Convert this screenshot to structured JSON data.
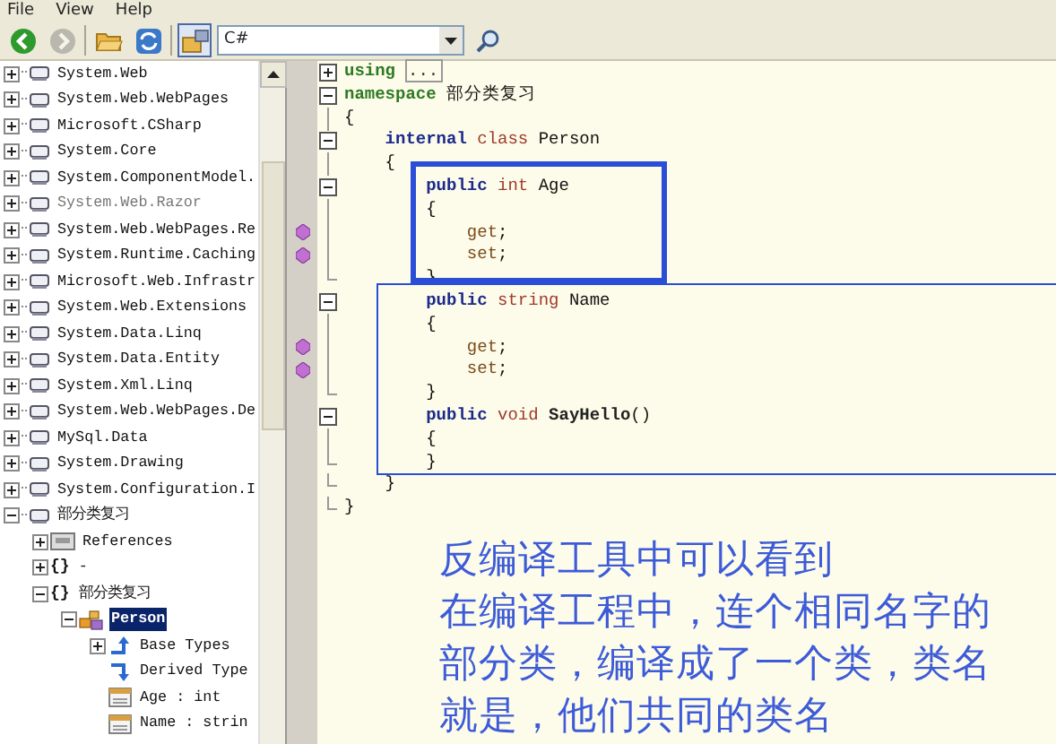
{
  "menu": [
    "File",
    "View",
    "Help"
  ],
  "toolbar": [
    {
      "kind": "back",
      "disabled": false,
      "pressed": false
    },
    {
      "kind": "forward",
      "disabled": true,
      "pressed": false
    },
    {
      "kind": "separator"
    },
    {
      "kind": "open",
      "disabled": false,
      "pressed": false
    },
    {
      "kind": "refresh",
      "disabled": false,
      "pressed": false
    },
    {
      "kind": "separator"
    },
    {
      "kind": "toggle",
      "disabled": false,
      "pressed": true
    }
  ],
  "language": {
    "value": "C#"
  },
  "tree": [
    {
      "kind": "assembly",
      "label": "System.Web",
      "expanded": false,
      "disabled": false,
      "selected": false
    },
    {
      "kind": "assembly",
      "label": "System.Web.WebPages",
      "expanded": false,
      "disabled": false,
      "selected": false
    },
    {
      "kind": "assembly",
      "label": "Microsoft.CSharp",
      "expanded": false,
      "disabled": false,
      "selected": false
    },
    {
      "kind": "assembly",
      "label": "System.Core",
      "expanded": false,
      "disabled": false,
      "selected": false
    },
    {
      "kind": "assembly",
      "label": "System.ComponentModel.",
      "expanded": false,
      "disabled": false,
      "selected": false
    },
    {
      "kind": "assembly",
      "label": "System.Web.Razor",
      "expanded": false,
      "disabled": true,
      "selected": false
    },
    {
      "kind": "assembly",
      "label": "System.Web.WebPages.Re",
      "expanded": false,
      "disabled": false,
      "selected": false
    },
    {
      "kind": "assembly",
      "label": "System.Runtime.Caching",
      "expanded": false,
      "disabled": false,
      "selected": false
    },
    {
      "kind": "assembly",
      "label": "Microsoft.Web.Infrastr",
      "expanded": false,
      "disabled": false,
      "selected": false
    },
    {
      "kind": "assembly",
      "label": "System.Web.Extensions",
      "expanded": false,
      "disabled": false,
      "selected": false
    },
    {
      "kind": "assembly",
      "label": "System.Data.Linq",
      "expanded": false,
      "disabled": false,
      "selected": false
    },
    {
      "kind": "assembly",
      "label": "System.Data.Entity",
      "expanded": false,
      "disabled": false,
      "selected": false
    },
    {
      "kind": "assembly",
      "label": "System.Xml.Linq",
      "expanded": false,
      "disabled": false,
      "selected": false
    },
    {
      "kind": "assembly",
      "label": "System.Web.WebPages.De",
      "expanded": false,
      "disabled": false,
      "selected": false
    },
    {
      "kind": "assembly",
      "label": "MySql.Data",
      "expanded": false,
      "disabled": false,
      "selected": false
    },
    {
      "kind": "assembly",
      "label": "System.Drawing",
      "expanded": false,
      "disabled": false,
      "selected": false
    },
    {
      "kind": "assembly",
      "label": "System.Configuration.I",
      "expanded": false,
      "disabled": false,
      "selected": false
    },
    {
      "kind": "assembly",
      "label": "部分类复习",
      "expanded": true,
      "disabled": false,
      "selected": false,
      "children": [
        {
          "kind": "references",
          "label": "References",
          "expanded": false,
          "disabled": false,
          "selected": false
        },
        {
          "kind": "namespace",
          "glyph": "{}",
          "label": "-",
          "expanded": false,
          "disabled": false,
          "selected": false
        },
        {
          "kind": "namespace",
          "glyph": "{}",
          "label": "部分类复习",
          "expanded": true,
          "disabled": false,
          "selected": false,
          "children": [
            {
              "kind": "class",
              "label": "Person",
              "expanded": true,
              "disabled": false,
              "selected": true,
              "children": [
                {
                  "kind": "base",
                  "label": "Base Types",
                  "expanded": false,
                  "disabled": false,
                  "selected": false
                },
                {
                  "kind": "derived",
                  "label": "Derived Type",
                  "disabled": false,
                  "selected": false
                },
                {
                  "kind": "property",
                  "label": "Age : int",
                  "disabled": false,
                  "selected": false
                },
                {
                  "kind": "property",
                  "label": "Name : strin",
                  "disabled": false,
                  "selected": false
                }
              ]
            }
          ]
        }
      ]
    }
  ],
  "code_lines": [
    {
      "kind": "plus",
      "marker": false,
      "tokens": [
        {
          "kind": "keyword2",
          "text": "using"
        },
        {
          "kind": "collapsed",
          "text": "..."
        }
      ]
    },
    {
      "kind": "minus",
      "marker": false,
      "tokens": [
        {
          "kind": "keyword2",
          "text": "namespace"
        },
        {
          "kind": "plain",
          "text": " 部分类复习"
        }
      ]
    },
    {
      "kind": "line",
      "marker": false,
      "tokens": [
        {
          "kind": "plain",
          "text": "{"
        }
      ]
    },
    {
      "kind": "minus",
      "marker": false,
      "tokens": [
        {
          "kind": "keyword",
          "text": "    internal"
        },
        {
          "kind": "type",
          "text": " class"
        },
        {
          "kind": "plain",
          "text": " Person"
        }
      ]
    },
    {
      "kind": "line",
      "marker": false,
      "tokens": [
        {
          "kind": "plain",
          "text": "    {"
        }
      ]
    },
    {
      "kind": "minus",
      "marker": false,
      "tokens": [
        {
          "kind": "keyword",
          "text": "        public"
        },
        {
          "kind": "type",
          "text": " int"
        },
        {
          "kind": "plain",
          "text": " Age"
        }
      ]
    },
    {
      "kind": "line",
      "marker": false,
      "tokens": [
        {
          "kind": "plain",
          "text": "        {"
        }
      ]
    },
    {
      "kind": "line",
      "marker": true,
      "tokens": [
        {
          "kind": "accessor",
          "text": "            get"
        },
        {
          "kind": "plain",
          "text": ";"
        }
      ]
    },
    {
      "kind": "line",
      "marker": true,
      "tokens": [
        {
          "kind": "accessor",
          "text": "            set"
        },
        {
          "kind": "plain",
          "text": ";"
        }
      ]
    },
    {
      "kind": "end",
      "marker": false,
      "tokens": [
        {
          "kind": "plain",
          "text": "        }"
        }
      ]
    },
    {
      "kind": "minus",
      "marker": false,
      "tokens": [
        {
          "kind": "keyword",
          "text": "        public"
        },
        {
          "kind": "type",
          "text": " string"
        },
        {
          "kind": "plain",
          "text": " Name"
        }
      ]
    },
    {
      "kind": "line",
      "marker": false,
      "tokens": [
        {
          "kind": "plain",
          "text": "        {"
        }
      ]
    },
    {
      "kind": "line",
      "marker": true,
      "tokens": [
        {
          "kind": "accessor",
          "text": "            get"
        },
        {
          "kind": "plain",
          "text": ";"
        }
      ]
    },
    {
      "kind": "line",
      "marker": true,
      "tokens": [
        {
          "kind": "accessor",
          "text": "            set"
        },
        {
          "kind": "plain",
          "text": ";"
        }
      ]
    },
    {
      "kind": "end",
      "marker": false,
      "tokens": [
        {
          "kind": "plain",
          "text": "        }"
        }
      ]
    },
    {
      "kind": "minus",
      "marker": false,
      "tokens": [
        {
          "kind": "keyword",
          "text": "        public"
        },
        {
          "kind": "type",
          "text": " void"
        },
        {
          "kind": "method",
          "text": " SayHello"
        },
        {
          "kind": "plain",
          "text": "()"
        }
      ]
    },
    {
      "kind": "line",
      "marker": false,
      "tokens": [
        {
          "kind": "plain",
          "text": "        {"
        }
      ]
    },
    {
      "kind": "end",
      "marker": false,
      "tokens": [
        {
          "kind": "plain",
          "text": "        }"
        }
      ]
    },
    {
      "kind": "end",
      "marker": false,
      "tokens": [
        {
          "kind": "plain",
          "text": "    }"
        }
      ]
    },
    {
      "kind": "end",
      "marker": false,
      "tokens": [
        {
          "kind": "plain",
          "text": "}"
        }
      ]
    }
  ],
  "annotation": [
    "反编译工具中可以看到",
    "在编译工程中，连个相同名字的",
    "部分类，编译成了一个类，类名",
    "就是，他们共同的类名"
  ]
}
